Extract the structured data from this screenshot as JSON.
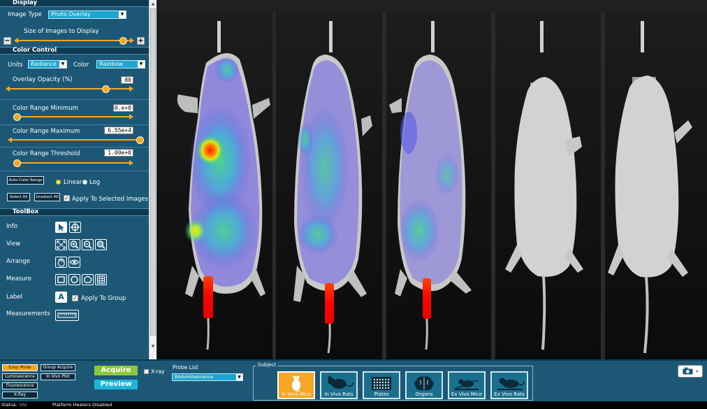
{
  "display": {
    "header": "Display",
    "image_type_label": "Image Type",
    "image_type_value": "Photo Overlay",
    "size_label": "Size of Images to Display",
    "size_level": 0.93
  },
  "color_control": {
    "header": "Color Control",
    "units_label": "Units",
    "units_value": "Radiance",
    "color_label": "Color",
    "color_value": "Rainbow",
    "opacity_label": "Overlay Opacity (%)",
    "opacity_value": "80",
    "opacity_level": 0.8,
    "range_min_label": "Color Range Minimum",
    "range_min_value": "0.e+0",
    "range_min_level": 0.0,
    "range_max_label": "Color Range Maximum",
    "range_max_value": "6.55e+4",
    "range_max_level": 0.97,
    "threshold_label": "Color Range Threshold",
    "threshold_value": "1.00e+0",
    "threshold_level": 0.0,
    "auto_range_button": "Auto Color Range",
    "linear_label": "Linear",
    "log_label": "Log",
    "scale_selected": "Linear",
    "select_all_button": "Select All",
    "unselect_all_button": "Unselect All",
    "apply_selected_label": "Apply To Selected Images"
  },
  "toolbox": {
    "header": "ToolBox",
    "info_label": "Info",
    "view_label": "View",
    "arrange_label": "Arrange",
    "measure_label": "Measure",
    "label_label": "Label",
    "apply_group_label": "Apply To Group",
    "measurements_label": "Measurements",
    "label_tool_glyph": "A"
  },
  "acquisition": {
    "modes": [
      "Easy Mode",
      "Luminescence",
      "Fluorescence",
      "X-Ray"
    ],
    "active_mode": "Easy Mode",
    "group_acquire": "Group Acquire",
    "in_vivo_plot": "In Vivo Plot",
    "acquire_button": "Acquire",
    "preview_button": "Preview",
    "xray_label": "X-ray",
    "probe_list_label": "Probe List",
    "probe_value": "Bioluminescence"
  },
  "subject": {
    "label": "Subject",
    "tiles": [
      "In Vivo Mice",
      "In Vivo Rats",
      "Plates",
      "Organs",
      "Ex Vivo Mice",
      "Ex Vivo Rats"
    ],
    "active": "In Vivo Mice"
  },
  "status": {
    "label": "Status:",
    "value": "Idle",
    "message": "Platform Heaters Disabled"
  },
  "colors": {
    "panel": "#1c5876",
    "header": "#0f3a52",
    "accent": "#f5a623",
    "select": "#1ca6cf",
    "acquire": "#8cc63f",
    "preview": "#1fb6d6"
  }
}
